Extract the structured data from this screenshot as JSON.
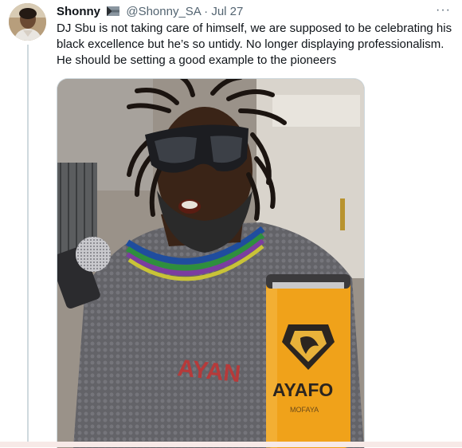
{
  "tweet": {
    "author_name": "Shonny",
    "author_handle": "@Shonny_SA",
    "separator": "·",
    "date": "Jul 27",
    "text": "DJ Sbu is not taking care of himself, we are supposed to be celebrating his black excellence but he’s so untidy. No longer displaying professionalism. He should be setting a good example to the pioneers",
    "more_label": "···"
  },
  "media": {
    "can_text": "AYAFO",
    "can_brand_small": "MOFAYA",
    "sweater_text": "AYAN"
  },
  "colors": {
    "handle_gray": "#536471",
    "border": "#cfd9de",
    "can_orange": "#f0a21a"
  }
}
